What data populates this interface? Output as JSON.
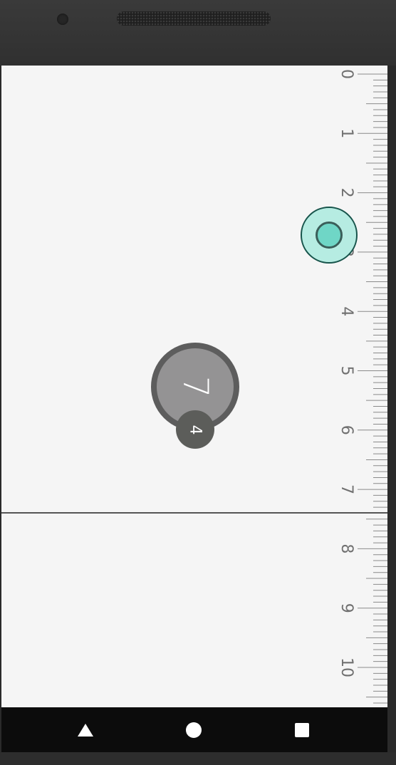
{
  "ruler": {
    "labels": [
      "0",
      "1",
      "2",
      "3",
      "4",
      "5",
      "6",
      "7",
      "8",
      "9",
      "10"
    ],
    "unit_spacing": 83.3,
    "ticks_per_unit": 10
  },
  "measurement": {
    "value": "7",
    "sub_value": "4"
  },
  "navigation": {
    "back_icon": "triangle-back-icon",
    "home_icon": "circle-home-icon",
    "recent_icon": "square-recents-icon"
  },
  "colors": {
    "screen_bg": "#f5f5f5",
    "handle_fill": "#b6ece2",
    "handle_inner": "#6fd6c6",
    "knob_fill": "#949394",
    "knob_border": "#5d5d5d",
    "badge_fill": "#5c5d5a",
    "navbar_bg": "#0c0c0c"
  }
}
